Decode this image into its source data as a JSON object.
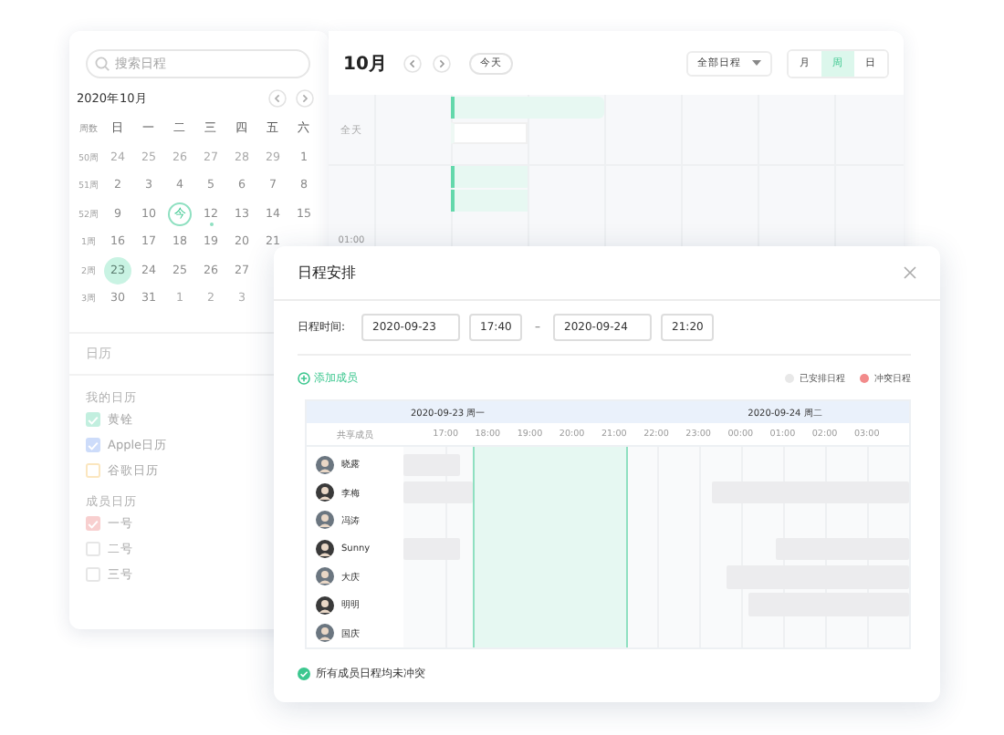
{
  "sidebar": {
    "search": {
      "placeholder": "搜索日程"
    },
    "month_title": "2020年10月",
    "weekday_header": [
      "周数",
      "日",
      "一",
      "二",
      "三",
      "四",
      "五",
      "六"
    ],
    "weeks": [
      {
        "label": "50周",
        "days": [
          {
            "text": "24",
            "muted": true,
            "selected": false,
            "today": false,
            "dot": false
          },
          {
            "text": "25",
            "muted": true,
            "selected": false,
            "today": false,
            "dot": false
          },
          {
            "text": "26",
            "muted": true,
            "selected": false,
            "today": false,
            "dot": false
          },
          {
            "text": "27",
            "muted": true,
            "selected": false,
            "today": false,
            "dot": false
          },
          {
            "text": "28",
            "muted": true,
            "selected": false,
            "today": false,
            "dot": false
          },
          {
            "text": "29",
            "muted": true,
            "selected": false,
            "today": false,
            "dot": false
          },
          {
            "text": "1",
            "muted": false,
            "selected": false,
            "today": false,
            "dot": false
          }
        ]
      },
      {
        "label": "51周",
        "days": [
          {
            "text": "2",
            "muted": false,
            "selected": false,
            "today": false,
            "dot": false
          },
          {
            "text": "3",
            "muted": false,
            "selected": false,
            "today": false,
            "dot": false
          },
          {
            "text": "4",
            "muted": false,
            "selected": false,
            "today": false,
            "dot": false
          },
          {
            "text": "5",
            "muted": false,
            "selected": false,
            "today": false,
            "dot": false
          },
          {
            "text": "6",
            "muted": false,
            "selected": false,
            "today": false,
            "dot": false
          },
          {
            "text": "7",
            "muted": false,
            "selected": false,
            "today": false,
            "dot": false
          },
          {
            "text": "8",
            "muted": false,
            "selected": false,
            "today": false,
            "dot": false
          }
        ]
      },
      {
        "label": "52周",
        "days": [
          {
            "text": "9",
            "muted": false,
            "selected": false,
            "today": false,
            "dot": false
          },
          {
            "text": "10",
            "muted": false,
            "selected": false,
            "today": false,
            "dot": false
          },
          {
            "text": "今",
            "muted": false,
            "selected": false,
            "today": true,
            "dot": false
          },
          {
            "text": "12",
            "muted": false,
            "selected": false,
            "today": false,
            "dot": true
          },
          {
            "text": "13",
            "muted": false,
            "selected": false,
            "today": false,
            "dot": false
          },
          {
            "text": "14",
            "muted": false,
            "selected": false,
            "today": false,
            "dot": false
          },
          {
            "text": "15",
            "muted": false,
            "selected": false,
            "today": false,
            "dot": false
          }
        ]
      },
      {
        "label": "1周",
        "days": [
          {
            "text": "16",
            "muted": false,
            "selected": false,
            "today": false,
            "dot": false
          },
          {
            "text": "17",
            "muted": false,
            "selected": false,
            "today": false,
            "dot": false
          },
          {
            "text": "18",
            "muted": false,
            "selected": false,
            "today": false,
            "dot": false
          },
          {
            "text": "19",
            "muted": false,
            "selected": false,
            "today": false,
            "dot": false
          },
          {
            "text": "20",
            "muted": false,
            "selected": false,
            "today": false,
            "dot": false
          },
          {
            "text": "21",
            "muted": false,
            "selected": false,
            "today": false,
            "dot": false
          }
        ]
      },
      {
        "label": "2周",
        "days": [
          {
            "text": "23",
            "muted": false,
            "selected": true,
            "today": false,
            "dot": false
          },
          {
            "text": "24",
            "muted": false,
            "selected": false,
            "today": false,
            "dot": false
          },
          {
            "text": "25",
            "muted": false,
            "selected": false,
            "today": false,
            "dot": false
          },
          {
            "text": "26",
            "muted": false,
            "selected": false,
            "today": false,
            "dot": false
          },
          {
            "text": "27",
            "muted": false,
            "selected": false,
            "today": false,
            "dot": false
          }
        ]
      },
      {
        "label": "3周",
        "days": [
          {
            "text": "30",
            "muted": false,
            "selected": false,
            "today": false,
            "dot": false
          },
          {
            "text": "31",
            "muted": false,
            "selected": false,
            "today": false,
            "dot": false
          },
          {
            "text": "1",
            "muted": true,
            "selected": false,
            "today": false,
            "dot": false
          },
          {
            "text": "2",
            "muted": true,
            "selected": false,
            "today": false,
            "dot": false
          },
          {
            "text": "3",
            "muted": true,
            "selected": false,
            "today": false,
            "dot": false
          }
        ]
      }
    ],
    "section_title": "日历",
    "groups": [
      {
        "title": "我的日历",
        "items": [
          {
            "label": "黄铨",
            "checked": true,
            "color": "#c2efdf"
          },
          {
            "label": "Apple日历",
            "checked": true,
            "color": "#cddcfa"
          },
          {
            "label": "谷歌日历",
            "checked": false,
            "color": "#fbe6bf"
          }
        ]
      },
      {
        "title": "成员日历",
        "items": [
          {
            "label": "一号",
            "checked": true,
            "color": "#f8cfcf"
          },
          {
            "label": "二号",
            "checked": false,
            "color": "#e6e6e6"
          },
          {
            "label": "三号",
            "checked": false,
            "color": "#e6e6e6"
          }
        ]
      }
    ]
  },
  "main": {
    "month": "10月",
    "today_button": "今天",
    "filter": "全部日程",
    "views": [
      {
        "label": "月",
        "selected": false
      },
      {
        "label": "周",
        "selected": true
      },
      {
        "label": "日",
        "selected": false
      }
    ],
    "all_day_label": "全天",
    "time_label": "01:00"
  },
  "dialog": {
    "title": "日程安排",
    "time_label": "日程时间:",
    "start_date": "2020-09-23",
    "start_time": "17:40",
    "separator": "–",
    "end_date": "2020-09-24",
    "end_time": "21:20",
    "add_member": "添加成员",
    "legend": [
      {
        "label": "已安排日程",
        "color": "#e8e8e8"
      },
      {
        "label": "冲突日程",
        "color": "#f28b8b"
      }
    ],
    "dates": [
      "2020-09-23 周一",
      "2020-09-24 周二"
    ],
    "member_header": "共享成员",
    "hours": [
      "17:00",
      "18:00",
      "19:00",
      "20:00",
      "21:00",
      "22:00",
      "23:00",
      "00:00",
      "01:00",
      "02:00",
      "03:00"
    ],
    "members": [
      {
        "name": "晓露"
      },
      {
        "name": "李梅"
      },
      {
        "name": "冯涛"
      },
      {
        "name": "Sunny"
      },
      {
        "name": "大庆"
      },
      {
        "name": "明明"
      },
      {
        "name": "国庆"
      }
    ],
    "status": "所有成员日程均未冲突"
  }
}
